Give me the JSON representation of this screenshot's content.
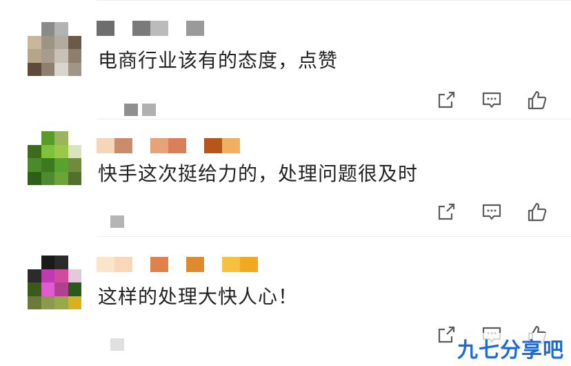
{
  "comments": [
    {
      "text": "电商行业该有的态度，点赞",
      "avatar_colors": [
        "#ffffff",
        "#8a8a8a",
        "#b3b3b3",
        "#ffffff",
        "#c8b79c",
        "#9e9486",
        "#b4aba0",
        "#6b5a48",
        "#b7a588",
        "#a89c8e",
        "#c9c1b6",
        "#8d7e6d",
        "#5e4a3a",
        "#8e7f6e",
        "#d9d4cc",
        "#a09586"
      ],
      "name_colors": [
        "#6e6e6e",
        "#ffffff",
        "#7a7a7a",
        "#bbbbbb",
        "#ffffff",
        "#9a9a9a"
      ],
      "meta_colors": [
        "#8f8f8f",
        "#b0b0b0"
      ]
    },
    {
      "text": "快手这次挺给力的，处理问题很及时",
      "avatar_colors": [
        "#ffffff",
        "#5a9a2a",
        "#9cb45c",
        "#ffffff",
        "#3b6b1b",
        "#7cc23a",
        "#9bc84a",
        "#d8e4c0",
        "#4b8a2a",
        "#3d7a1f",
        "#5aa230",
        "#6e8c3a",
        "#2e5e18",
        "#4d8a30",
        "#6aa43a",
        "#50702c"
      ],
      "name_colors": [
        "#f4d6b8",
        "#c98d6a",
        "#ffffff",
        "#e8a27a",
        "#d8805a",
        "#ffffff",
        "#b5561a",
        "#f0b060"
      ],
      "meta_colors": [
        "#b5b5b5"
      ]
    },
    {
      "text": "这样的处理大快人心！",
      "avatar_colors": [
        "#ffffff",
        "#1a1a1a",
        "#2a2a2a",
        "#ffffff",
        "#2b2b2b",
        "#c23ab2",
        "#d04aa0",
        "#e4c8d8",
        "#3a5a1a",
        "#e25ad0",
        "#b04090",
        "#2a5a1a",
        "#6b7a3a",
        "#8a9a4a",
        "#9aa84a",
        "#d8b020"
      ],
      "name_colors": [
        "#fce4c8",
        "#f8d8b8",
        "#ffffff",
        "#e0804a",
        "#ffffff",
        "#e08a30",
        "#ffffff",
        "#f6c040",
        "#f2a820"
      ],
      "meta_colors": [
        "#e0e0e0"
      ]
    }
  ],
  "actions": {
    "icons": [
      "share-icon",
      "comment-icon",
      "like-icon"
    ]
  },
  "watermark": {
    "text": "九七分享吧",
    "color": "#1e6bd8"
  }
}
